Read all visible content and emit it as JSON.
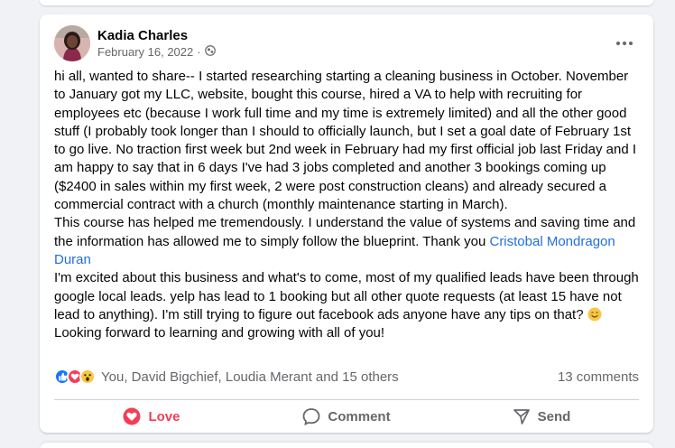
{
  "post": {
    "author": "Kadia Charles",
    "date": "February 16, 2022",
    "privacy_icon": "globe-icon",
    "paragraphs": {
      "p1": "hi all, wanted to share-- I started researching starting a cleaning business in October. November to January got my LLC, website, bought this course, hired a VA to help with recruiting for employees etc (because I work full time and my time is extremely limited) and all the other good stuff (I probably took longer than I should to officially launch, but I set a goal date of February 1st to go live. No traction first week but 2nd week in February had my first official job last Friday and I am happy to say that in 6 days I've had 3 jobs completed and another 3 bookings coming up ($2400 in sales within my first week, 2 were post construction cleans) and already secured a commercial contract with a church (monthly maintenance starting in March).",
      "p2_before": "This course has helped me tremendously. I understand the value of systems and saving time and the information has allowed me to simply follow the blueprint. Thank you ",
      "p2_mention": "Cristobal Mondragon Duran",
      "p3": "I'm excited about this business and what's to come, most of my qualified leads have been through google local leads. yelp has lead to 1 booking but all other quote requests (at least 15 have not lead to anything). I'm still trying to figure out facebook ads anyone have any tips on that? ",
      "p4": "Looking forward to learning and growing with all of you!"
    },
    "reactions": {
      "icons": [
        "like-icon",
        "love-icon",
        "wow-icon"
      ],
      "names": "You, David Bigchief, Loudia Merant and 15 others",
      "comments": "13 comments"
    },
    "actions": {
      "love": "Love",
      "comment": "Comment",
      "send": "Send"
    },
    "colors": {
      "love": "#f33e58",
      "mention": "#216fdb",
      "like": "#1877f2",
      "muted": "#65676b"
    }
  }
}
